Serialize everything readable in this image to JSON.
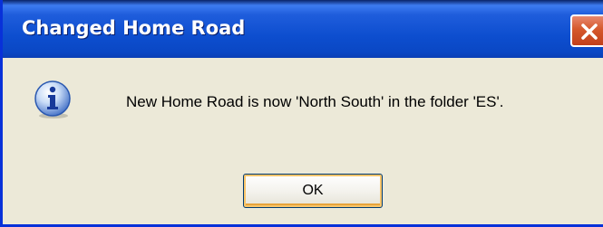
{
  "window": {
    "title": "Changed Home Road",
    "close_icon": "close-icon"
  },
  "dialog": {
    "icon": "info-icon",
    "message": "New Home Road is now 'North South' in the folder 'ES'.",
    "ok_label": "OK"
  },
  "colors": {
    "titlebar_blue": "#0d4ecf",
    "dialog_background": "#ece9d8",
    "close_red": "#d5582c",
    "button_focus": "#f7c46a"
  }
}
